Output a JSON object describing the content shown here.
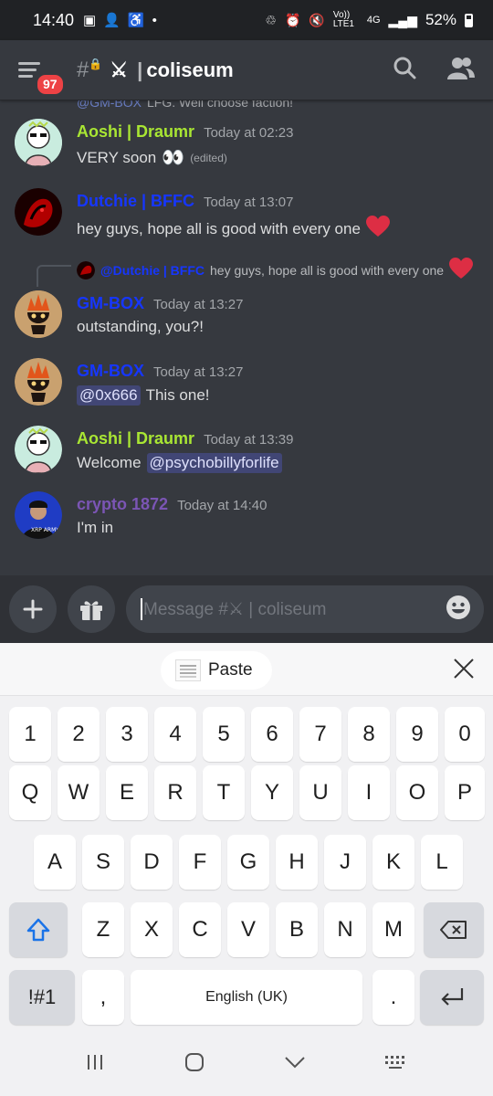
{
  "status_bar": {
    "time": "14:40",
    "battery": "52%",
    "volte": "Vo)) LTE1",
    "network": "4G"
  },
  "header": {
    "badge": "97",
    "channel_prefix": "⚔",
    "channel": "coliseum"
  },
  "cut_reply": {
    "user": "@GM-BOX",
    "text": "LFG. Well choose faction!"
  },
  "messages": [
    {
      "user": "Aoshi | Draumr",
      "time": "Today at 02:23",
      "text": "VERY soon",
      "emoji": "👀",
      "edited": "(edited)"
    },
    {
      "user": "Dutchie | BFFC",
      "time": "Today at 13:07",
      "text": "hey guys, hope all is good with every one",
      "emoji": "❤️"
    },
    {
      "reply_user": "@Dutchie | BFFC",
      "reply_text": "hey guys, hope all is good with every one",
      "user": "GM-BOX",
      "time": "Today at 13:27",
      "text": "outstanding, you?!"
    },
    {
      "user": "GM-BOX",
      "time": "Today at 13:27",
      "mention": "@0x666",
      "text": "This one!"
    },
    {
      "user": "Aoshi | Draumr",
      "time": "Today at 13:39",
      "text": "Welcome",
      "mention": "@psychobillyforlife"
    },
    {
      "user": "crypto 1872",
      "time": "Today at 14:40",
      "text": "I'm in",
      "avatar_text": "XRP ARMY"
    }
  ],
  "composer": {
    "placeholder": "Message #⚔ | coliseum"
  },
  "keyboard": {
    "paste_label": "Paste",
    "numbers": [
      "1",
      "2",
      "3",
      "4",
      "5",
      "6",
      "7",
      "8",
      "9",
      "0"
    ],
    "row1": [
      "Q",
      "W",
      "E",
      "R",
      "T",
      "Y",
      "U",
      "I",
      "O",
      "P"
    ],
    "row2": [
      "A",
      "S",
      "D",
      "F",
      "G",
      "H",
      "J",
      "K",
      "L"
    ],
    "row3": [
      "Z",
      "X",
      "C",
      "V",
      "B",
      "N",
      "M"
    ],
    "symbols_label": "!#1",
    "comma": ",",
    "space_label": "English (UK)",
    "period": "."
  },
  "colors": {
    "background": "#36393f",
    "green_role": "#a9e633",
    "blue_role": "#1636ff",
    "purple_role": "#7b55b5",
    "mention_bg": "#414675"
  }
}
